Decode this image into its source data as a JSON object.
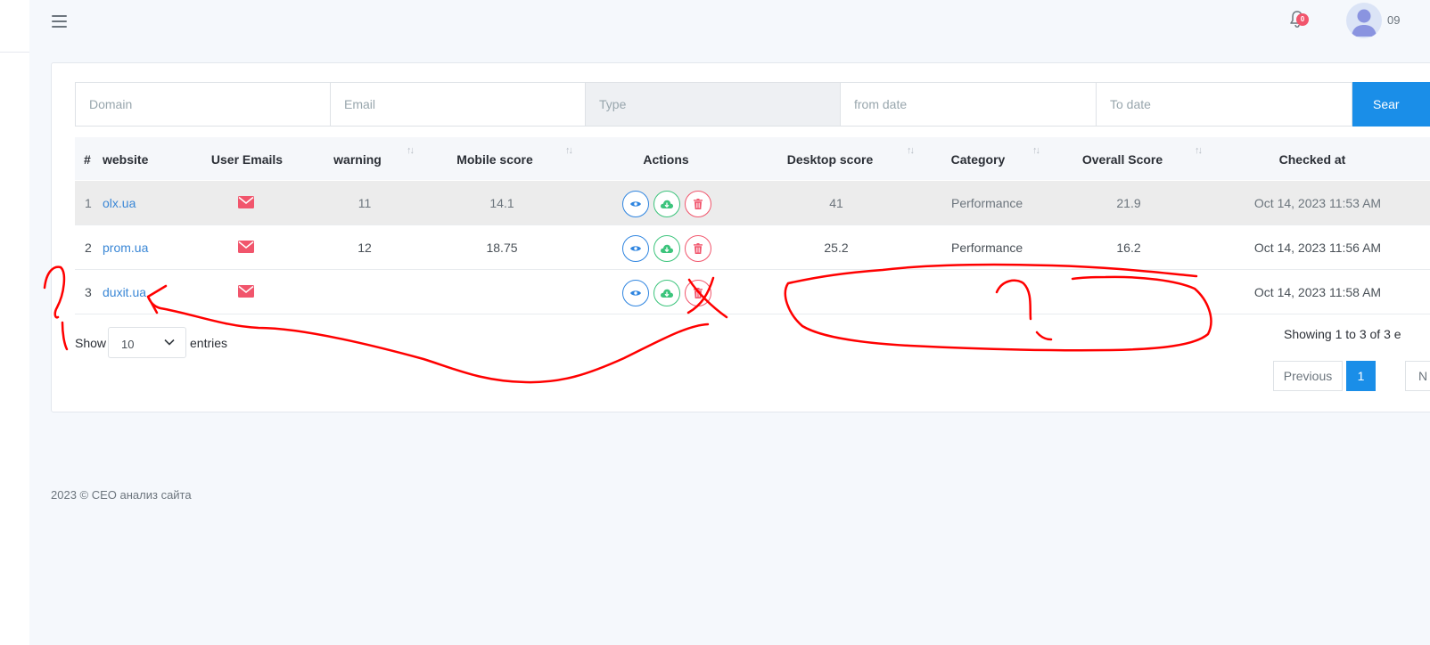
{
  "header": {
    "notification_count": "0",
    "user_name_fragment": "09"
  },
  "filters": {
    "domain_placeholder": "Domain",
    "email_placeholder": "Email",
    "type_placeholder": "Type",
    "from_date_placeholder": "from date",
    "to_date_placeholder": "To date",
    "search_label": "Sear"
  },
  "table": {
    "columns": [
      "#",
      "website",
      "User Emails",
      "warning",
      "Mobile score",
      "Actions",
      "Desktop score",
      "Category",
      "Overall Score",
      "Checked at"
    ],
    "rows": [
      {
        "num": "1",
        "website": "olx.ua",
        "warning": "11",
        "mobile": "14.1",
        "desktop": "41",
        "category": "Performance",
        "overall": "21.9",
        "checked": "Oct 14, 2023 11:53 AM"
      },
      {
        "num": "2",
        "website": "prom.ua",
        "warning": "12",
        "mobile": "18.75",
        "desktop": "25.2",
        "category": "Performance",
        "overall": "16.2",
        "checked": "Oct 14, 2023 11:56 AM"
      },
      {
        "num": "3",
        "website": "duxit.ua",
        "warning": "",
        "mobile": "",
        "desktop": "",
        "category": "",
        "overall": "",
        "checked": "Oct 14, 2023 11:58 AM"
      }
    ]
  },
  "length_menu": {
    "show_label": "Show",
    "value": "10",
    "entries_label": "entries"
  },
  "info_text": "Showing 1 to 3 of 3 e",
  "pagination": {
    "previous": "Previous",
    "current": "1",
    "next_fragment": "N"
  },
  "footer": {
    "text": "2023 © СЕО анализ сайта"
  },
  "colors": {
    "primary": "#1a8ee8",
    "link": "#3a87d6",
    "success": "#3cc47c",
    "danger": "#f1556c",
    "annotation": "#ff0000"
  },
  "icons": [
    "menu-icon",
    "bell-icon",
    "avatar-icon",
    "mail-icon",
    "eye-icon",
    "cloud-download-icon",
    "trash-icon",
    "chevron-down-icon",
    "sort-icon"
  ]
}
